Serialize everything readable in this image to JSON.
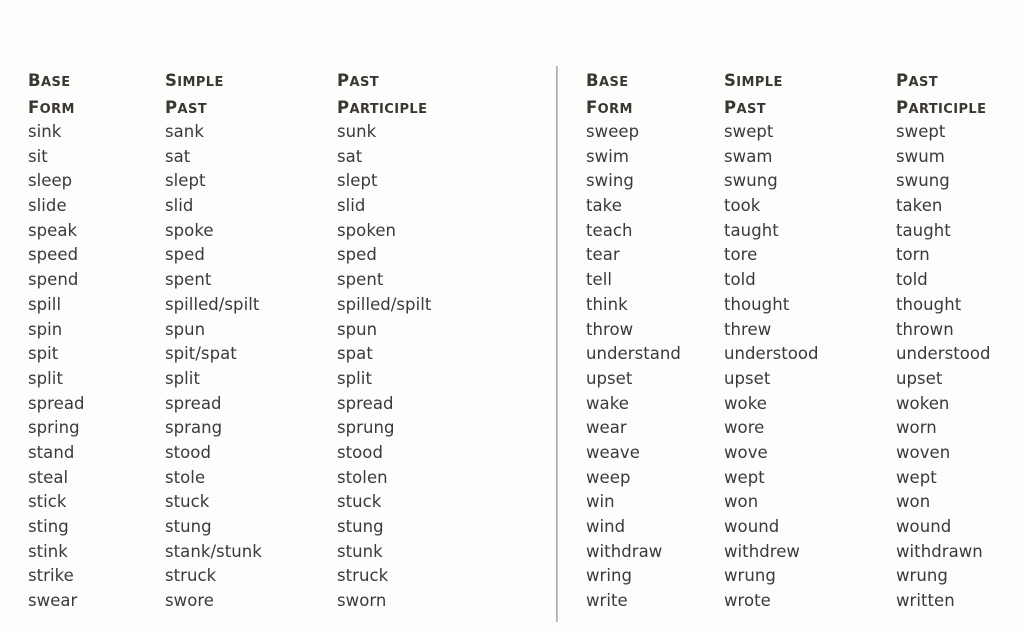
{
  "page": {
    "background_color": "#fdfdfc",
    "text_color": "#3b3a38",
    "divider_color": "#9a9a98"
  },
  "columns": {
    "base_form": {
      "word1": "Base",
      "word2": "Form"
    },
    "simple_past": {
      "word1": "Simple",
      "word2": "Past"
    },
    "past_participle": {
      "word1": "Past",
      "word2": "Participle"
    }
  },
  "table_data": {
    "type": "table",
    "headers": [
      "Base Form",
      "Simple Past",
      "Past Participle"
    ],
    "left_panel": [
      [
        "sink",
        "sank",
        "sunk"
      ],
      [
        "sit",
        "sat",
        "sat"
      ],
      [
        "sleep",
        "slept",
        "slept"
      ],
      [
        "slide",
        "slid",
        "slid"
      ],
      [
        "speak",
        "spoke",
        "spoken"
      ],
      [
        "speed",
        "sped",
        "sped"
      ],
      [
        "spend",
        "spent",
        "spent"
      ],
      [
        "spill",
        "spilled/spilt",
        "spilled/spilt"
      ],
      [
        "spin",
        "spun",
        "spun"
      ],
      [
        "spit",
        "spit/spat",
        "spat"
      ],
      [
        "split",
        "split",
        "split"
      ],
      [
        "spread",
        "spread",
        "spread"
      ],
      [
        "spring",
        "sprang",
        "sprung"
      ],
      [
        "stand",
        "stood",
        "stood"
      ],
      [
        "steal",
        "stole",
        "stolen"
      ],
      [
        "stick",
        "stuck",
        "stuck"
      ],
      [
        "sting",
        "stung",
        "stung"
      ],
      [
        "stink",
        "stank/stunk",
        "stunk"
      ],
      [
        "strike",
        "struck",
        "struck"
      ],
      [
        "swear",
        "swore",
        "sworn"
      ]
    ],
    "right_panel": [
      [
        "sweep",
        "swept",
        "swept"
      ],
      [
        "swim",
        "swam",
        "swum"
      ],
      [
        "swing",
        "swung",
        "swung"
      ],
      [
        "take",
        "took",
        "taken"
      ],
      [
        "teach",
        "taught",
        "taught"
      ],
      [
        "tear",
        "tore",
        "torn"
      ],
      [
        "tell",
        "told",
        "told"
      ],
      [
        "think",
        "thought",
        "thought"
      ],
      [
        "throw",
        "threw",
        "thrown"
      ],
      [
        "understand",
        "understood",
        "understood"
      ],
      [
        "upset",
        "upset",
        "upset"
      ],
      [
        "wake",
        "woke",
        "woken"
      ],
      [
        "wear",
        "wore",
        "worn"
      ],
      [
        "weave",
        "wove",
        "woven"
      ],
      [
        "weep",
        "wept",
        "wept"
      ],
      [
        "win",
        "won",
        "won"
      ],
      [
        "wind",
        "wound",
        "wound"
      ],
      [
        "withdraw",
        "withdrew",
        "withdrawn"
      ],
      [
        "wring",
        "wrung",
        "wrung"
      ],
      [
        "write",
        "wrote",
        "written"
      ]
    ]
  }
}
